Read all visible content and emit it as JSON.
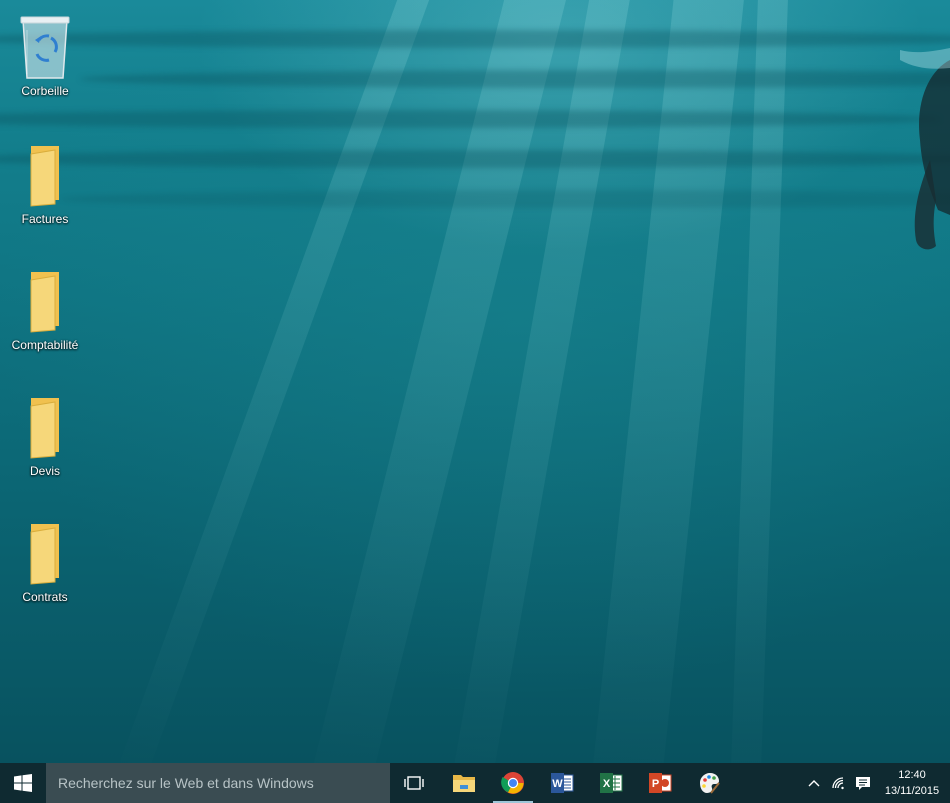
{
  "desktop": {
    "icons": [
      {
        "label": "Corbeille",
        "icon": "recycle-bin-icon"
      },
      {
        "label": "Factures",
        "icon": "folder-icon"
      },
      {
        "label": "Comptabilité",
        "icon": "folder-icon"
      },
      {
        "label": "Devis",
        "icon": "folder-icon"
      },
      {
        "label": "Contrats",
        "icon": "folder-icon"
      }
    ]
  },
  "taskbar": {
    "start_icon": "windows-logo-icon",
    "search": {
      "placeholder": "Recherchez sur le Web et dans Windows"
    },
    "apps": [
      {
        "icon": "task-view-icon",
        "active": false
      },
      {
        "icon": "file-explorer-icon",
        "active": false
      },
      {
        "icon": "chrome-icon",
        "active": true
      },
      {
        "icon": "word-icon",
        "active": false
      },
      {
        "icon": "excel-icon",
        "active": false
      },
      {
        "icon": "powerpoint-icon",
        "active": false
      },
      {
        "icon": "paint-icon",
        "active": false
      }
    ],
    "tray": {
      "icons": [
        "show-hidden-icons-chevron-icon",
        "wifi-icon",
        "action-center-icon"
      ],
      "time": "12:40",
      "date": "13/11/2015"
    }
  },
  "colors": {
    "taskbar": "#0f2a31",
    "search_box": "#3a4c52",
    "folder": "#f5d36e",
    "active_indicator": "#9ec6d8"
  }
}
